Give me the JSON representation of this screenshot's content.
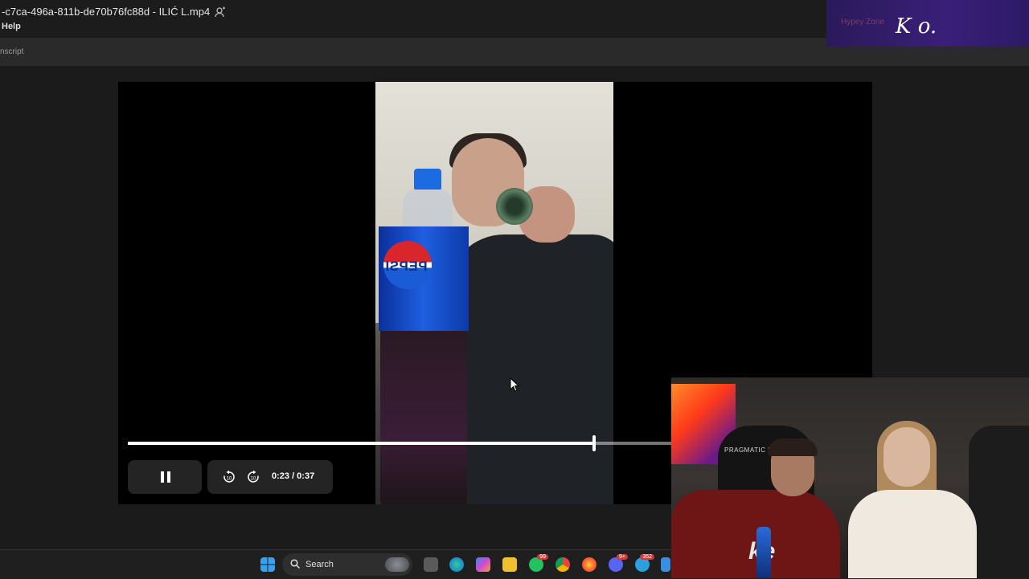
{
  "window": {
    "file_title": "-c7ca-496a-811b-de70b76fc88d - ILIĆ L.mp4",
    "menu_help": "Help",
    "subbar_text": "nscript"
  },
  "stream_overlay": {
    "faint_text": "Hypey Zone",
    "logo_text": "K o."
  },
  "video": {
    "bottle_brand": "PEPSI",
    "progress_fraction": 0.858,
    "elapsed": "0:23",
    "duration": "0:37",
    "time_display": "0:23 / 0:37",
    "state": "playing"
  },
  "controls": {
    "pause_icon": "pause-icon",
    "rewind_icon": "rewind-10-icon",
    "forward_icon": "forward-10-icon"
  },
  "taskbar": {
    "search_label": "Search",
    "icons": [
      "windows-start-icon",
      "search-icon",
      "task-view-icon",
      "edge-icon",
      "copilot-icon",
      "file-explorer-icon",
      "whatsapp-icon",
      "chrome-icon",
      "firefox-icon",
      "discord-icon",
      "telegram-icon",
      "notepad-icon"
    ],
    "badges": {
      "whatsapp": "99",
      "discord": "9+",
      "telegram": "352"
    }
  },
  "webcam": {
    "chair_brand": "PRAGMATIC PLAY",
    "shirt_text": "ke"
  },
  "colors": {
    "accent_progress": "#ffffff",
    "player_bg": "#000000",
    "app_bg": "#1b1b1b"
  }
}
